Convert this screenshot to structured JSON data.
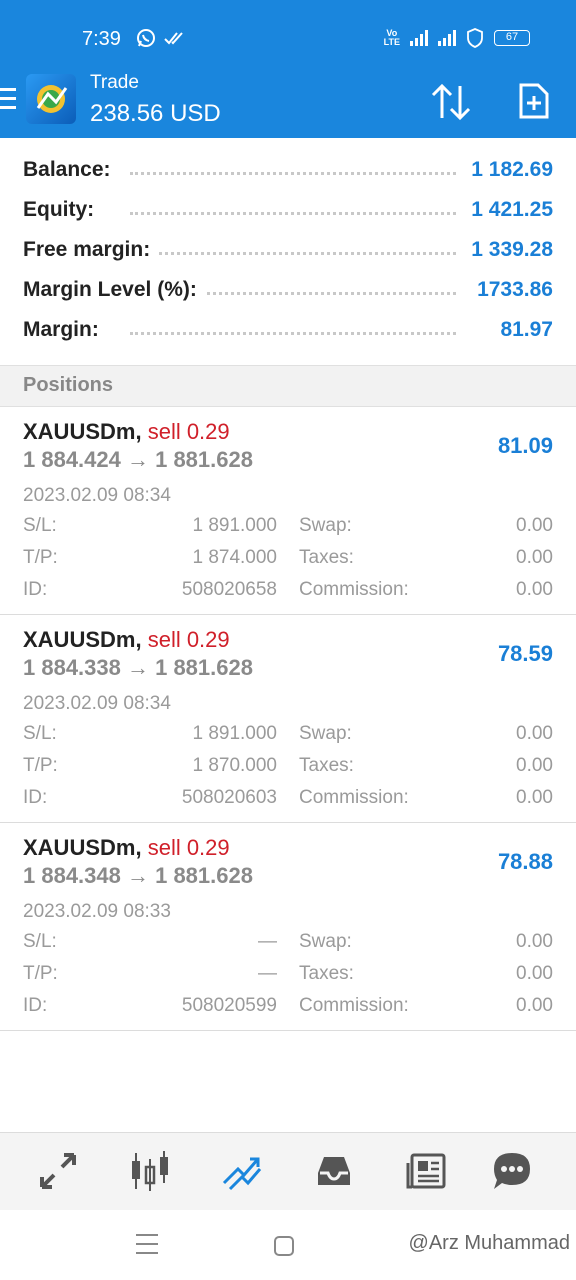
{
  "status_bar": {
    "time": "7:39",
    "battery": "67"
  },
  "appbar": {
    "title": "Trade",
    "balance": "238.56 USD"
  },
  "summary": [
    {
      "label": "Balance:",
      "value": "1 182.69"
    },
    {
      "label": "Equity:",
      "value": "1 421.25"
    },
    {
      "label": "Free margin:",
      "value": "1 339.28"
    },
    {
      "label": "Margin Level (%):",
      "value": "1733.86"
    },
    {
      "label": "Margin:",
      "value": "81.97"
    }
  ],
  "positions_header": "Positions",
  "positions": [
    {
      "symbol": "XAUUSDm,",
      "side": "sell 0.29",
      "prices": "1 884.424 → 1 881.628",
      "profit": "81.09",
      "time": "2023.02.09 08:34",
      "sl_label": "S/L:",
      "sl": "1 891.000",
      "swap_label": "Swap:",
      "swap": "0.00",
      "tp_label": "T/P:",
      "tp": "1 874.000",
      "taxes_label": "Taxes:",
      "taxes": "0.00",
      "id_label": "ID:",
      "id": "508020658",
      "commission_label": "Commission:",
      "commission": "0.00"
    },
    {
      "symbol": "XAUUSDm,",
      "side": "sell 0.29",
      "prices": "1 884.338 → 1 881.628",
      "profit": "78.59",
      "time": "2023.02.09 08:34",
      "sl_label": "S/L:",
      "sl": "1 891.000",
      "swap_label": "Swap:",
      "swap": "0.00",
      "tp_label": "T/P:",
      "tp": "1 870.000",
      "taxes_label": "Taxes:",
      "taxes": "0.00",
      "id_label": "ID:",
      "id": "508020603",
      "commission_label": "Commission:",
      "commission": "0.00"
    },
    {
      "symbol": "XAUUSDm,",
      "side": "sell 0.29",
      "prices": "1 884.348 → 1 881.628",
      "profit": "78.88",
      "time": "2023.02.09 08:33",
      "sl_label": "S/L:",
      "sl": "—",
      "swap_label": "Swap:",
      "swap": "0.00",
      "tp_label": "T/P:",
      "tp": "—",
      "taxes_label": "Taxes:",
      "taxes": "0.00",
      "id_label": "ID:",
      "id": "508020599",
      "commission_label": "Commission:",
      "commission": "0.00"
    }
  ],
  "bottom_nav": [
    {
      "icon": "quotes-icon",
      "active": false
    },
    {
      "icon": "chart-icon",
      "active": false
    },
    {
      "icon": "trade-icon",
      "active": true
    },
    {
      "icon": "history-icon",
      "active": false
    },
    {
      "icon": "news-icon",
      "active": false
    },
    {
      "icon": "chat-icon",
      "active": false
    }
  ],
  "watermark": "@Arz Muhammad",
  "colors": {
    "brand": "#1a86dd",
    "value_blue": "#1a7fd6",
    "sell_red": "#d0202a",
    "muted_gray": "#9a9a9a"
  }
}
